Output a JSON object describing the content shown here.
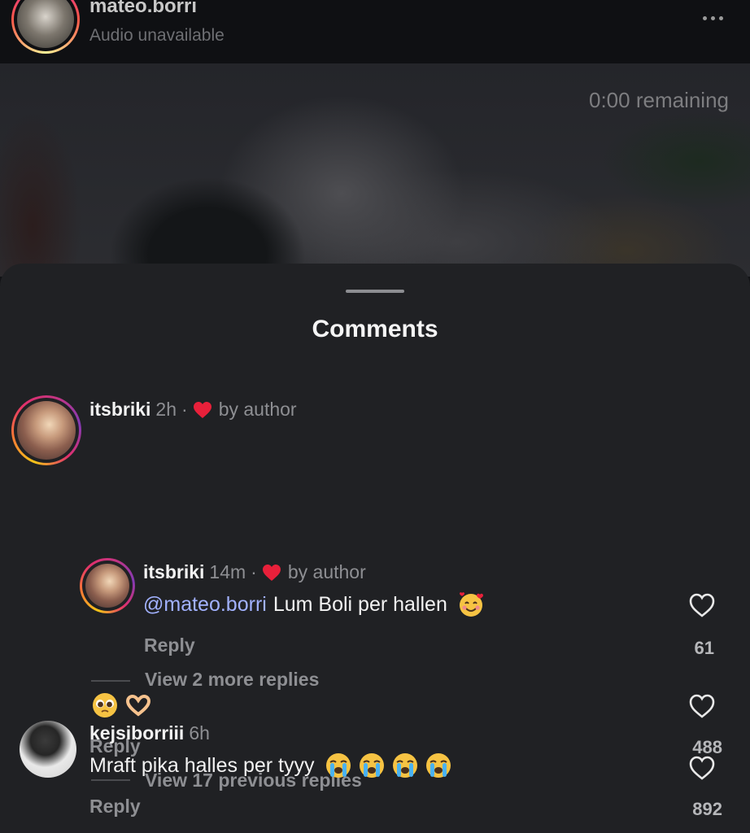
{
  "header": {
    "username": "mateo.borri",
    "subtitle": "Audio unavailable",
    "more_icon": "more-horizontal-icon",
    "remaining": "0:00 remaining"
  },
  "sheet": {
    "title": "Comments"
  },
  "comments": [
    {
      "username": "itsbriki",
      "time": "2h",
      "separator": "·",
      "liked_by_author": "by author",
      "emojis": [
        "pleading-face",
        "heart-hands"
      ],
      "reply_label": "Reply",
      "likes": "488",
      "view_replies": "View 17 previous replies"
    },
    {
      "username": "itsbriki",
      "time": "14m",
      "separator": "·",
      "liked_by_author": "by author",
      "mention": "@mateo.borri",
      "text": "Lum Boli per hallen",
      "emojis": [
        "smiling-face-with-hearts"
      ],
      "reply_label": "Reply",
      "likes": "61",
      "view_replies": "View 2 more replies"
    },
    {
      "username": "kejsiborriii",
      "time": "6h",
      "text": "Mraft pika halles per tyyy",
      "emojis": [
        "loudly-crying-face",
        "loudly-crying-face",
        "loudly-crying-face",
        "loudly-crying-face"
      ],
      "reply_label": "Reply",
      "likes": "892"
    }
  ],
  "colors": {
    "mention": "#a2b2ff",
    "heart_red": "#e8203a",
    "sheet_bg": "#202124"
  }
}
